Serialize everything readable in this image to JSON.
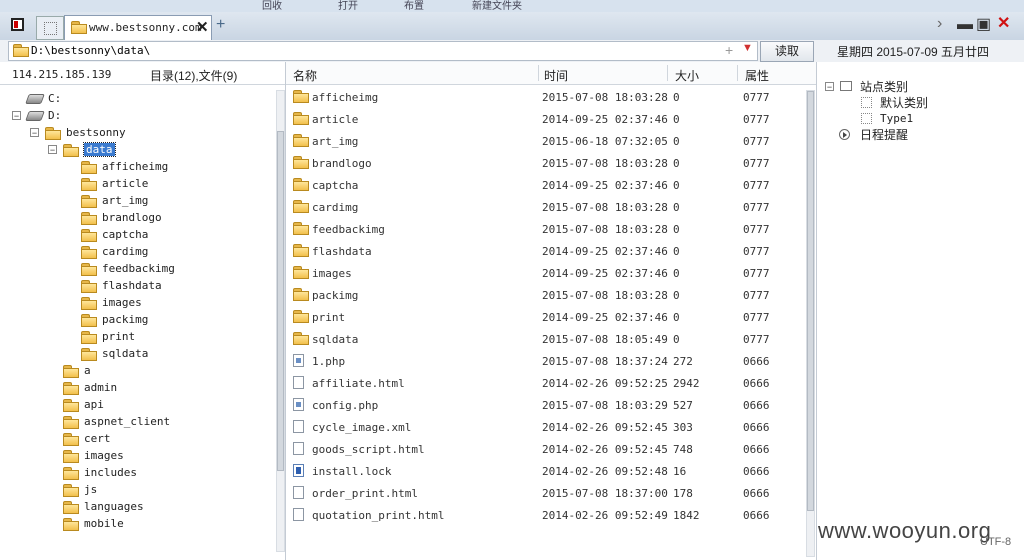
{
  "top_menu": [
    "回收",
    "打开",
    "布置",
    "新建文件夹"
  ],
  "tab": {
    "title": "www.bestsonny.com"
  },
  "address": {
    "path": "D:\\bestsonny\\data\\",
    "read_label": "读取"
  },
  "date_display": "星期四 2015-07-09 五月廿四",
  "left": {
    "ip": "114.215.185.139",
    "count": "目录(12),文件(9)",
    "tree": [
      {
        "label": "C:",
        "depth": 0,
        "type": "drive",
        "expand": ""
      },
      {
        "label": "D:",
        "depth": 0,
        "type": "drive",
        "expand": "−"
      },
      {
        "label": "bestsonny",
        "depth": 1,
        "type": "folder",
        "expand": "−"
      },
      {
        "label": "data",
        "depth": 2,
        "type": "folder-open",
        "expand": "−",
        "selected": true
      },
      {
        "label": "afficheimg",
        "depth": 3,
        "type": "folder",
        "expand": ""
      },
      {
        "label": "article",
        "depth": 3,
        "type": "folder",
        "expand": ""
      },
      {
        "label": "art_img",
        "depth": 3,
        "type": "folder",
        "expand": ""
      },
      {
        "label": "brandlogo",
        "depth": 3,
        "type": "folder",
        "expand": ""
      },
      {
        "label": "captcha",
        "depth": 3,
        "type": "folder",
        "expand": ""
      },
      {
        "label": "cardimg",
        "depth": 3,
        "type": "folder",
        "expand": ""
      },
      {
        "label": "feedbackimg",
        "depth": 3,
        "type": "folder",
        "expand": ""
      },
      {
        "label": "flashdata",
        "depth": 3,
        "type": "folder",
        "expand": ""
      },
      {
        "label": "images",
        "depth": 3,
        "type": "folder",
        "expand": ""
      },
      {
        "label": "packimg",
        "depth": 3,
        "type": "folder",
        "expand": ""
      },
      {
        "label": "print",
        "depth": 3,
        "type": "folder",
        "expand": ""
      },
      {
        "label": "sqldata",
        "depth": 3,
        "type": "folder",
        "expand": ""
      },
      {
        "label": "a",
        "depth": 2,
        "type": "folder",
        "expand": ""
      },
      {
        "label": "admin",
        "depth": 2,
        "type": "folder",
        "expand": ""
      },
      {
        "label": "api",
        "depth": 2,
        "type": "folder",
        "expand": ""
      },
      {
        "label": "aspnet_client",
        "depth": 2,
        "type": "folder",
        "expand": ""
      },
      {
        "label": "cert",
        "depth": 2,
        "type": "folder",
        "expand": ""
      },
      {
        "label": "images",
        "depth": 2,
        "type": "folder",
        "expand": ""
      },
      {
        "label": "includes",
        "depth": 2,
        "type": "folder",
        "expand": ""
      },
      {
        "label": "js",
        "depth": 2,
        "type": "folder",
        "expand": ""
      },
      {
        "label": "languages",
        "depth": 2,
        "type": "folder",
        "expand": ""
      },
      {
        "label": "mobile",
        "depth": 2,
        "type": "folder",
        "expand": ""
      }
    ]
  },
  "files": {
    "columns": {
      "name": "名称",
      "time": "时间",
      "size": "大小",
      "attr": "属性"
    },
    "rows": [
      {
        "name": "afficheimg",
        "time": "2015-07-08 18:03:28",
        "size": "0",
        "attr": "0777",
        "icon": "folder"
      },
      {
        "name": "article",
        "time": "2014-09-25 02:37:46",
        "size": "0",
        "attr": "0777",
        "icon": "folder"
      },
      {
        "name": "art_img",
        "time": "2015-06-18 07:32:05",
        "size": "0",
        "attr": "0777",
        "icon": "folder"
      },
      {
        "name": "brandlogo",
        "time": "2015-07-08 18:03:28",
        "size": "0",
        "attr": "0777",
        "icon": "folder"
      },
      {
        "name": "captcha",
        "time": "2014-09-25 02:37:46",
        "size": "0",
        "attr": "0777",
        "icon": "folder"
      },
      {
        "name": "cardimg",
        "time": "2015-07-08 18:03:28",
        "size": "0",
        "attr": "0777",
        "icon": "folder"
      },
      {
        "name": "feedbackimg",
        "time": "2015-07-08 18:03:28",
        "size": "0",
        "attr": "0777",
        "icon": "folder"
      },
      {
        "name": "flashdata",
        "time": "2014-09-25 02:37:46",
        "size": "0",
        "attr": "0777",
        "icon": "folder"
      },
      {
        "name": "images",
        "time": "2014-09-25 02:37:46",
        "size": "0",
        "attr": "0777",
        "icon": "folder"
      },
      {
        "name": "packimg",
        "time": "2015-07-08 18:03:28",
        "size": "0",
        "attr": "0777",
        "icon": "folder"
      },
      {
        "name": "print",
        "time": "2014-09-25 02:37:46",
        "size": "0",
        "attr": "0777",
        "icon": "folder"
      },
      {
        "name": "sqldata",
        "time": "2015-07-08 18:05:49",
        "size": "0",
        "attr": "0777",
        "icon": "folder"
      },
      {
        "name": "1.php",
        "time": "2015-07-08 18:37:24",
        "size": "272",
        "attr": "0666",
        "icon": "php"
      },
      {
        "name": "affiliate.html",
        "time": "2014-02-26 09:52:25",
        "size": "2942",
        "attr": "0666",
        "icon": "file"
      },
      {
        "name": "config.php",
        "time": "2015-07-08 18:03:29",
        "size": "527",
        "attr": "0666",
        "icon": "php"
      },
      {
        "name": "cycle_image.xml",
        "time": "2014-02-26 09:52:45",
        "size": "303",
        "attr": "0666",
        "icon": "file"
      },
      {
        "name": "goods_script.html",
        "time": "2014-02-26 09:52:45",
        "size": "748",
        "attr": "0666",
        "icon": "file"
      },
      {
        "name": "install.lock",
        "time": "2014-02-26 09:52:48",
        "size": "16",
        "attr": "0666",
        "icon": "lock"
      },
      {
        "name": "order_print.html",
        "time": "2015-07-08 18:37:00",
        "size": "178",
        "attr": "0666",
        "icon": "file"
      },
      {
        "name": "quotation_print.html",
        "time": "2014-02-26 09:52:49",
        "size": "1842",
        "attr": "0666",
        "icon": "file"
      }
    ]
  },
  "right": {
    "root": "站点类别",
    "children": [
      "默认类别",
      "Type1"
    ],
    "reminder": "日程提醒"
  },
  "watermark": "www.wooyun.org",
  "encoding": "UTF-8"
}
